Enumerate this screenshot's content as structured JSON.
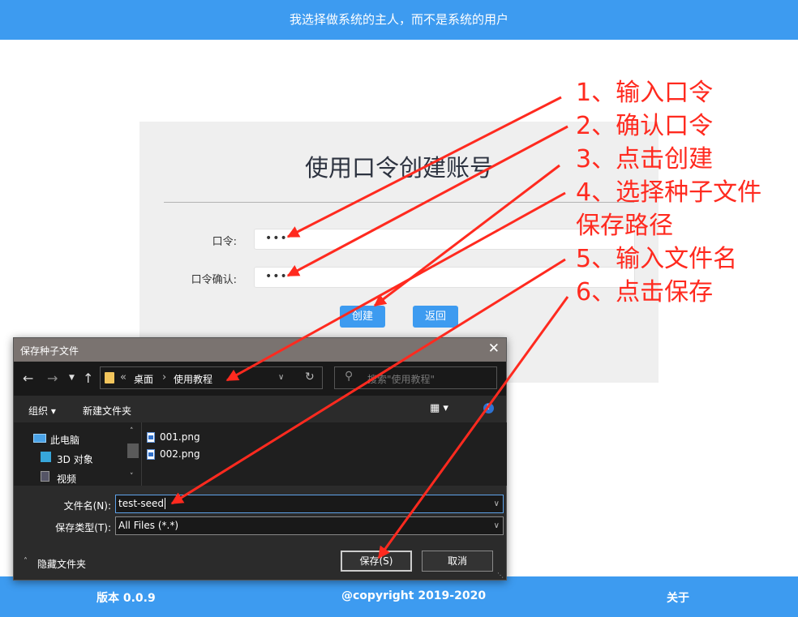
{
  "header": {
    "slogan": "我选择做系统的主人，而不是系统的用户"
  },
  "form": {
    "title": "使用口令创建账号",
    "password_label": "口令:",
    "password_value": "•••",
    "confirm_label": "口令确认:",
    "confirm_value": "•••",
    "create_label": "创建",
    "back_label": "返回"
  },
  "footer": {
    "version": "版本 0.0.9",
    "copyright": "@copyright 2019-2020",
    "about": "关于"
  },
  "dialog": {
    "title": "保存种子文件",
    "close_glyph": "✕",
    "breadcrumb": {
      "overflow": "«",
      "folder1": "桌面",
      "sep": "›",
      "folder2": "使用教程"
    },
    "search_placeholder": "搜索\"使用教程\"",
    "toolbar": {
      "organize": "组织 ▾",
      "new_folder": "新建文件夹"
    },
    "nav_tree": [
      {
        "label": "此电脑"
      },
      {
        "label": "3D 对象"
      },
      {
        "label": "视频"
      }
    ],
    "files": [
      {
        "name": "001.png"
      },
      {
        "name": "002.png"
      }
    ],
    "filename_label": "文件名(N):",
    "filename_value": "test-seed",
    "savetype_label": "保存类型(T):",
    "savetype_value": "All Files (*.*)",
    "hide_folders": "隐藏文件夹",
    "save_label": "保存(S)",
    "cancel_label": "取消"
  },
  "annotations": [
    "1、输入口令",
    "2、确认口令",
    "3、点击创建",
    "4、选择种子文件",
    "保存路径",
    "5、输入文件名",
    "6、点击保存"
  ],
  "colors": {
    "accent": "#3d9bf0",
    "annotation": "#ff2a1f",
    "dialog_bg": "#1f1f1f",
    "dialog_titlebar": "#7a7370"
  },
  "icons": [
    "back-arrow-icon",
    "forward-arrow-icon",
    "up-arrow-icon",
    "folder-icon",
    "refresh-icon",
    "search-icon",
    "view-icon",
    "help-icon",
    "computer-icon",
    "3d-objects-icon",
    "video-icon",
    "png-file-icon",
    "chevron-up-icon",
    "close-icon"
  ]
}
